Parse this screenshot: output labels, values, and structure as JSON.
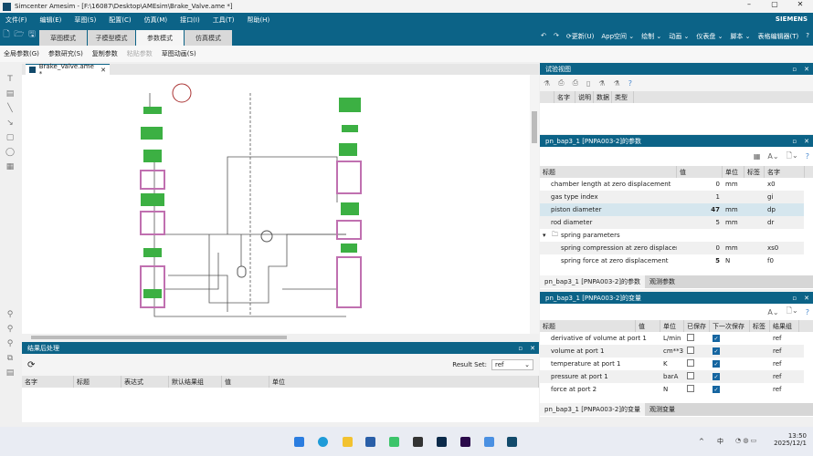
{
  "window": {
    "title": "Simcenter Amesim - [F:\\16087\\Desktop\\AMEsim\\Brake_Valve.ame *]",
    "brand": "SIEMENS",
    "controls": [
      "–",
      "▢",
      "✕"
    ]
  },
  "menu": [
    "文件(F)",
    "编辑(E)",
    "草图(S)",
    "配置(C)",
    "仿真(M)",
    "接口(I)",
    "工具(T)",
    "帮助(H)"
  ],
  "mode_tabs": [
    {
      "label": "草图模式"
    },
    {
      "label": "子模型模式"
    },
    {
      "label": "参数模式",
      "active": true
    },
    {
      "label": "仿真模式"
    }
  ],
  "right_tools": [
    "↶",
    "↷",
    "更新(U)",
    "App空间",
    "绘制",
    "动画",
    "仪表盘",
    "脚本",
    "表格编辑器(T)",
    "?"
  ],
  "toolbar": [
    {
      "label": "全局参数(G)"
    },
    {
      "label": "参数研究(S)"
    },
    {
      "label": "复制参数"
    },
    {
      "label": "粘贴参数",
      "disabled": true
    },
    {
      "label": "草图动画(S)"
    }
  ],
  "document_tab": {
    "label": "Brake_Valve.ame *",
    "close": "✕"
  },
  "test_view": {
    "title": "试验视图",
    "columns": [
      "名字",
      "说明",
      "数据",
      "类型"
    ]
  },
  "params": {
    "title": "pn_bap3_1 [PNPA003-2]的参数",
    "columns": [
      "标题",
      "值",
      "单位",
      "标签",
      "名字"
    ],
    "rows": [
      {
        "title": "chamber length at zero displacement",
        "value": "0",
        "unit": "mm",
        "tag": "",
        "name": "x0"
      },
      {
        "title": "gas type index",
        "value": "1",
        "unit": "",
        "tag": "",
        "name": "gi"
      },
      {
        "title": "piston diameter",
        "value": "47",
        "unit": "mm",
        "tag": "",
        "name": "dp",
        "bold": true,
        "selected": true
      },
      {
        "title": "rod diameter",
        "value": "5",
        "unit": "mm",
        "tag": "",
        "name": "dr"
      },
      {
        "title": "spring parameters",
        "group": true
      },
      {
        "title": "spring compression at zero displacem...",
        "value": "0",
        "unit": "mm",
        "tag": "",
        "name": "xs0",
        "indent": true
      },
      {
        "title": "spring force at zero displacement",
        "value": "5",
        "unit": "N",
        "tag": "",
        "name": "f0",
        "bold": true,
        "indent": true
      }
    ],
    "tabs": [
      "pn_bap3_1 [PNPA003-2]的参数",
      "观测参数"
    ]
  },
  "vars": {
    "title": "pn_bap3_1 [PNPA003-2]的变量",
    "columns": [
      "标题",
      "值",
      "单位",
      "已保存",
      "下一次保存",
      "标签",
      "结果组"
    ],
    "rows": [
      {
        "title": "derivative of volume at port 1",
        "unit": "L/min",
        "saved": false,
        "next": true,
        "group": "ref"
      },
      {
        "title": "volume at port 1",
        "unit": "cm**3",
        "saved": false,
        "next": true,
        "group": "ref"
      },
      {
        "title": "temperature at port 1",
        "unit": "K",
        "saved": false,
        "next": true,
        "group": "ref"
      },
      {
        "title": "pressure at port 1",
        "unit": "barA",
        "saved": false,
        "next": true,
        "group": "ref"
      },
      {
        "title": "force at port 2",
        "unit": "N",
        "saved": false,
        "next": true,
        "group": "ref"
      }
    ],
    "tabs": [
      "pn_bap3_1 [PNPA003-2]的变量",
      "观测变量"
    ]
  },
  "post": {
    "title": "结果后处理",
    "result_set_label": "Result Set:",
    "result_set_value": "ref",
    "columns": [
      "名字",
      "标题",
      "表达式",
      "默认结果组",
      "值",
      "单位"
    ]
  },
  "tray": {
    "ime": "中",
    "time": "13:50",
    "date": "2025/12/1"
  },
  "colors": {
    "accent": "#0c6387",
    "component_green": "#3cb043",
    "component_pink": "#c070b0"
  }
}
